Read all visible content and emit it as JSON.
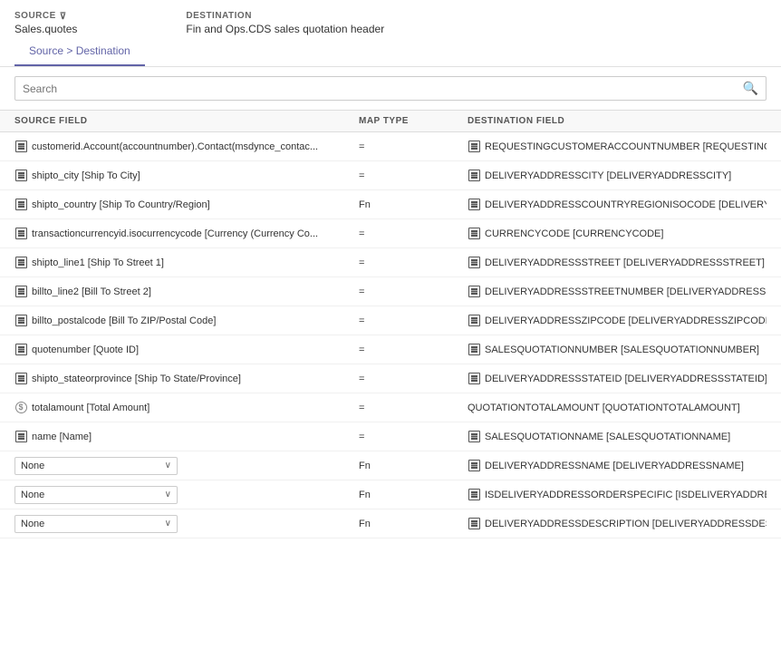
{
  "header": {
    "source_label": "SOURCE",
    "source_value": "Sales.quotes",
    "destination_label": "DESTINATION",
    "destination_value": "Fin and Ops.CDS sales quotation header"
  },
  "breadcrumb": "Source > Destination",
  "search": {
    "placeholder": "Search"
  },
  "columns": {
    "source_field": "SOURCE FIELD",
    "map_type": "MAP TYPE",
    "destination_field": "DESTINATION FIELD"
  },
  "rows": [
    {
      "source": "customerid.Account(accountnumber).Contact(msdynce_contac...",
      "source_icon": "field",
      "map_type": "=",
      "destination": "REQUESTINGCUSTOMERACCOUNTNUMBER [REQUESTINGCUS...",
      "dest_icon": "field"
    },
    {
      "source": "shipto_city [Ship To City]",
      "source_icon": "field",
      "map_type": "=",
      "destination": "DELIVERYADDRESSCITY [DELIVERYADDRESSCITY]",
      "dest_icon": "field"
    },
    {
      "source": "shipto_country [Ship To Country/Region]",
      "source_icon": "field",
      "map_type": "Fn",
      "destination": "DELIVERYADDRESSCOUNTRYREGIONISOCODE [DELIVERYADD...",
      "dest_icon": "field"
    },
    {
      "source": "transactioncurrencyid.isocurrencycode [Currency (Currency Co...",
      "source_icon": "field",
      "map_type": "=",
      "destination": "CURRENCYCODE [CURRENCYCODE]",
      "dest_icon": "field"
    },
    {
      "source": "shipto_line1 [Ship To Street 1]",
      "source_icon": "field",
      "map_type": "=",
      "destination": "DELIVERYADDRESSSTREET [DELIVERYADDRESSSTREET]",
      "dest_icon": "field"
    },
    {
      "source": "billto_line2 [Bill To Street 2]",
      "source_icon": "field",
      "map_type": "=",
      "destination": "DELIVERYADDRESSSTREETNUMBER [DELIVERYADDRESSSTREET...",
      "dest_icon": "field"
    },
    {
      "source": "billto_postalcode [Bill To ZIP/Postal Code]",
      "source_icon": "field",
      "map_type": "=",
      "destination": "DELIVERYADDRESSZIPCODE [DELIVERYADDRESSZIPCODE]",
      "dest_icon": "field"
    },
    {
      "source": "quotenumber [Quote ID]",
      "source_icon": "field",
      "map_type": "=",
      "destination": "SALESQUOTATIONNUMBER [SALESQUOTATIONNUMBER]",
      "dest_icon": "field"
    },
    {
      "source": "shipto_stateorprovince [Ship To State/Province]",
      "source_icon": "field",
      "map_type": "=",
      "destination": "DELIVERYADDRESSSTATEID [DELIVERYADDRESSSTATEID]",
      "dest_icon": "field"
    },
    {
      "source": "totalamount [Total Amount]",
      "source_icon": "money",
      "map_type": "=",
      "destination": "QUOTATIONTOTALAMOUNT [QUOTATIONTOTALAMOUNT]",
      "dest_icon": "none"
    },
    {
      "source": "name [Name]",
      "source_icon": "field",
      "map_type": "=",
      "destination": "SALESQUOTATIONNAME [SALESQUOTATIONNAME]",
      "dest_icon": "field"
    },
    {
      "source": "None",
      "source_icon": "dropdown",
      "map_type": "Fn",
      "destination": "DELIVERYADDRESSNAME [DELIVERYADDRESSNAME]",
      "dest_icon": "field"
    },
    {
      "source": "None",
      "source_icon": "dropdown",
      "map_type": "Fn",
      "destination": "ISDELIVERYADDRESSORDERSPECIFIC [ISDELIVERYADDRESSOR...",
      "dest_icon": "field"
    },
    {
      "source": "None",
      "source_icon": "dropdown",
      "map_type": "Fn",
      "destination": "DELIVERYADDRESSDESCRIPTION [DELIVERYADDRESSDESCRIPT...",
      "dest_icon": "field"
    }
  ]
}
